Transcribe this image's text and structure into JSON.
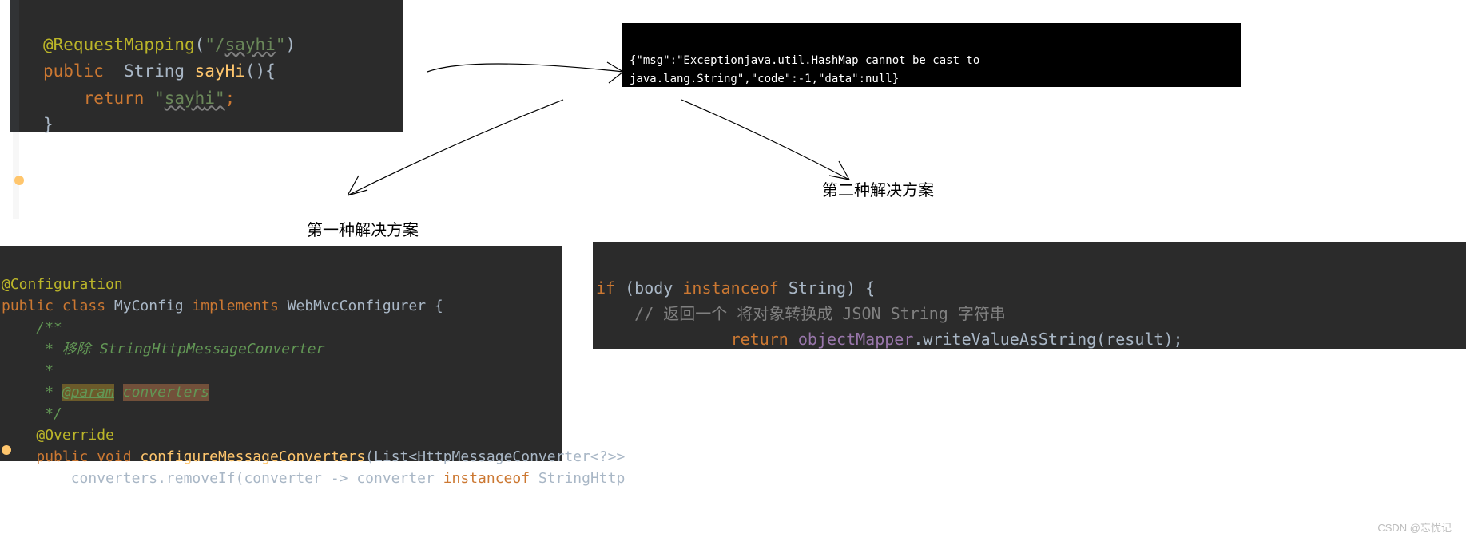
{
  "code1": {
    "line1_annotation": "@RequestMapping",
    "line1_paren_open": "(",
    "line1_string": "\"/",
    "line1_string_und": "sayhi",
    "line1_string_close": "\"",
    "line1_paren_close": ")",
    "line2_kw": "public",
    "line2_type": "  String ",
    "line2_fn": "sayHi",
    "line2_rest": "(){",
    "line3_kw": "return ",
    "line3_str_open": "\"",
    "line3_str_und": "sayh",
    "line3_cursor": "|",
    "line3_str_close": "i\"",
    "line3_semi": ";",
    "line4": "}"
  },
  "error": {
    "text": "{\"msg\":\"Exceptionjava.util.HashMap cannot be cast to java.lang.String\",\"code\":-1,\"data\":null}"
  },
  "labels": {
    "sol1": "第一种解决方案",
    "sol2": "第二种解决方案"
  },
  "code3": {
    "line1": "@Configuration",
    "line2_kw1": "public class ",
    "line2_cls": "MyConfig ",
    "line2_kw2": "implements ",
    "line2_impl": "WebMvcConfigurer {",
    "line3": "/**",
    "line4_star": " * ",
    "line4_txt": "移除 StringHttpMessageConverter",
    "line5": " *",
    "line6_star": " * ",
    "line6_tag": "@param",
    "line6_sp": " ",
    "line6_p": "converters",
    "line7": " */",
    "line8": "@Override",
    "line9_kw": "public void ",
    "line9_fn": "configureMessageConverters",
    "line9_rest": "(List<HttpMessageConverter<?>>",
    "line10_a": "    converters.removeIf(converter -> converter ",
    "line10_kw": "instanceof ",
    "line10_b": "StringHttp"
  },
  "code4": {
    "line1_kw1": "if ",
    "line1_a": "(body ",
    "line1_kw2": "instanceof ",
    "line1_b": "String) {",
    "line2_cm": "// 返回一个 将对象转换成 JSON String 字符串",
    "line3_kw": "return ",
    "line3_obj": "objectMapper",
    "line3_rest": ".writeValueAsString(result);"
  },
  "watermark": "CSDN @忘忧记"
}
